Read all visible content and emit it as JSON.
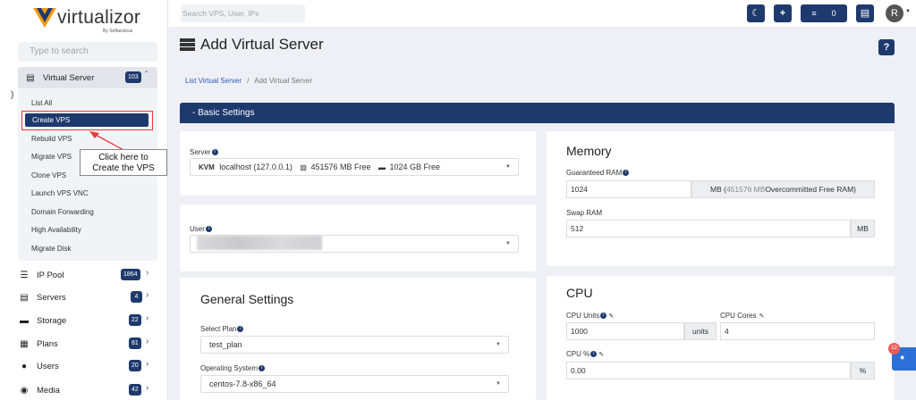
{
  "logo": {
    "name": "virtualizor",
    "by": "By Softaculous"
  },
  "sidebar": {
    "search_placeholder": "Type to search",
    "virtual_server": {
      "label": "Virtual Server",
      "count": "103"
    },
    "sub_items": [
      "List All",
      "Create VPS",
      "Rebuild VPS",
      "Migrate VPS",
      "Clone VPS",
      "Launch VPS VNC",
      "Domain Forwarding",
      "High Availability",
      "Migrate Disk"
    ],
    "items": [
      {
        "label": "IP Pool",
        "count": "1864"
      },
      {
        "label": "Servers",
        "count": "4"
      },
      {
        "label": "Storage",
        "count": "22"
      },
      {
        "label": "Plans",
        "count": "81"
      },
      {
        "label": "Users",
        "count": "20"
      },
      {
        "label": "Media",
        "count": "42"
      }
    ],
    "callout": "Click here to\nCreate the VPS",
    "paren": ")"
  },
  "topbar": {
    "search_placeholder": "Search VPS, User, IPs",
    "task_count": "0",
    "avatar": "R"
  },
  "page": {
    "title": "Add Virtual Server",
    "help": "?",
    "breadcrumb_link": "List Virtual Server",
    "breadcrumb_sep": "/",
    "breadcrumb_current": "Add Virtual Server",
    "section": "- Basic Settings"
  },
  "server": {
    "label": "Server",
    "type": "KVM",
    "name": "localhost (127.0.0.1)",
    "ram_free": "451576 MB Free",
    "disk_free": "1024 GB Free"
  },
  "user": {
    "label": "User"
  },
  "general": {
    "title": "General Settings",
    "plan_label": "Select Plan",
    "plan_value": "test_plan",
    "os_label": "Operating System",
    "os_value": "centos-7.8-x86_64"
  },
  "memory": {
    "title": "Memory",
    "guaranteed_label": "Guaranteed RAM",
    "guaranteed_value": "1024",
    "guaranteed_unit_prefix": "MB (",
    "guaranteed_unit_mb": "451576 MB",
    "guaranteed_unit_suffix": "Overcommitted Free RAM)",
    "swap_label": "Swap RAM",
    "swap_value": "512",
    "swap_unit": "MB"
  },
  "cpu": {
    "title": "CPU",
    "units_label": "CPU Units",
    "units_value": "1000",
    "units_unit": "units",
    "cores_label": "CPU Cores",
    "cores_value": "4",
    "percent_label": "CPU %",
    "percent_value": "0.00",
    "percent_unit": "%"
  },
  "notification": {
    "count": "12"
  },
  "colors": {
    "primary": "#1e3a6d",
    "highlight": "#e63a3a",
    "background": "#eef0f5"
  }
}
